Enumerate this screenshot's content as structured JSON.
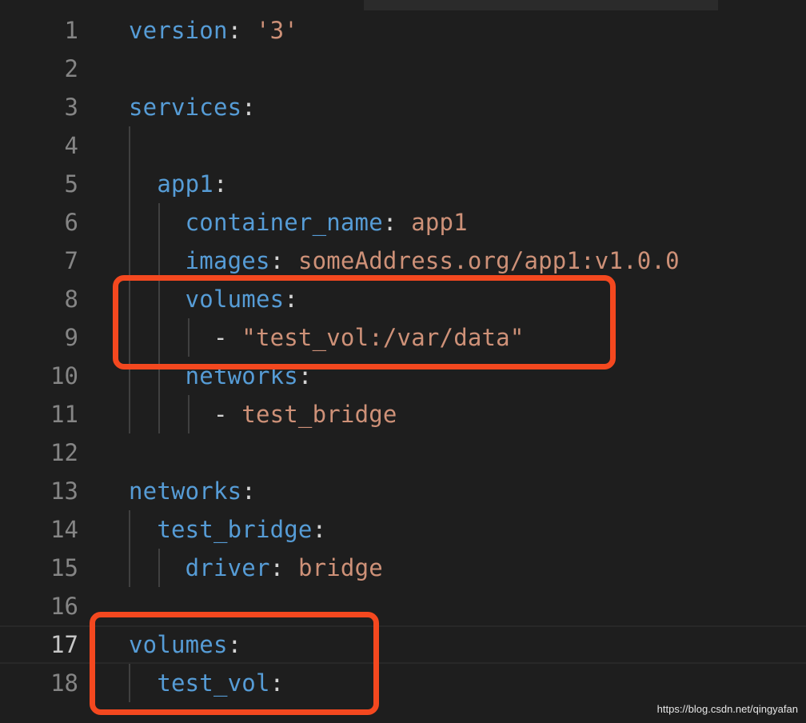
{
  "editor": {
    "lines": [
      {
        "num": "1",
        "key": "version",
        "colon": ": ",
        "value": "'3'"
      },
      {
        "num": "2"
      },
      {
        "num": "3",
        "key": "services",
        "colon": ":"
      },
      {
        "num": "4"
      },
      {
        "num": "5",
        "indent": "  ",
        "key": "app1",
        "colon": ":"
      },
      {
        "num": "6",
        "indent": "    ",
        "key": "container_name",
        "colon": ": ",
        "value": "app1"
      },
      {
        "num": "7",
        "indent": "    ",
        "key": "images",
        "colon": ": ",
        "value": "someAddress.org/app1:v1.0.0"
      },
      {
        "num": "8",
        "indent": "    ",
        "key": "volumes",
        "colon": ":"
      },
      {
        "num": "9",
        "indent": "      ",
        "dash": "- ",
        "value": "\"test_vol:/var/data\""
      },
      {
        "num": "10",
        "indent": "    ",
        "key": "networks",
        "colon": ":"
      },
      {
        "num": "11",
        "indent": "      ",
        "dash": "- ",
        "value": "test_bridge"
      },
      {
        "num": "12"
      },
      {
        "num": "13",
        "key": "networks",
        "colon": ":"
      },
      {
        "num": "14",
        "indent": "  ",
        "key": "test_bridge",
        "colon": ":"
      },
      {
        "num": "15",
        "indent": "    ",
        "key": "driver",
        "colon": ": ",
        "value": "bridge"
      },
      {
        "num": "16"
      },
      {
        "num": "17",
        "key": "volumes",
        "colon": ":",
        "current": true
      },
      {
        "num": "18",
        "indent": "  ",
        "key": "test_vol",
        "colon": ":"
      }
    ]
  },
  "colors": {
    "background": "#1e1e1e",
    "key": "#569cd6",
    "string": "#ce9178",
    "punctuation": "#d4d4d4",
    "line_number": "#858585",
    "highlight_box": "#f4481f"
  },
  "watermark": "https://blog.csdn.net/qingyafan"
}
